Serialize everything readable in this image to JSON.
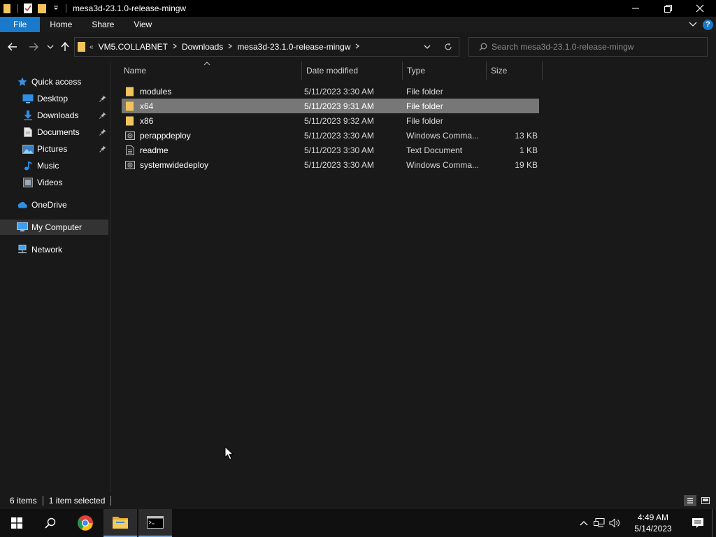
{
  "window": {
    "title": "mesa3d-23.1.0-release-mingw"
  },
  "ribbon": {
    "tabs": [
      "File",
      "Home",
      "Share",
      "View"
    ]
  },
  "address": {
    "overflow": "«",
    "crumbs": [
      "VM5.COLLABNET",
      "Downloads",
      "mesa3d-23.1.0-release-mingw"
    ]
  },
  "search": {
    "placeholder": "Search mesa3d-23.1.0-release-mingw"
  },
  "navpane": {
    "quick_access": "Quick access",
    "items": [
      {
        "label": "Desktop",
        "icon": "desktop-icon",
        "pinned": true
      },
      {
        "label": "Downloads",
        "icon": "download-icon",
        "pinned": true
      },
      {
        "label": "Documents",
        "icon": "documents-icon",
        "pinned": true
      },
      {
        "label": "Pictures",
        "icon": "pictures-icon",
        "pinned": true
      },
      {
        "label": "Music",
        "icon": "music-icon",
        "pinned": false
      },
      {
        "label": "Videos",
        "icon": "videos-icon",
        "pinned": false
      }
    ],
    "onedrive": "OneDrive",
    "my_computer": "My Computer",
    "network": "Network"
  },
  "columns": {
    "name": "Name",
    "date": "Date modified",
    "type": "Type",
    "size": "Size"
  },
  "files": [
    {
      "name": "modules",
      "date": "5/11/2023 3:30 AM",
      "type": "File folder",
      "size": "",
      "icon": "folder-icon",
      "selected": false
    },
    {
      "name": "x64",
      "date": "5/11/2023 9:31 AM",
      "type": "File folder",
      "size": "",
      "icon": "folder-icon",
      "selected": true
    },
    {
      "name": "x86",
      "date": "5/11/2023 9:32 AM",
      "type": "File folder",
      "size": "",
      "icon": "folder-icon",
      "selected": false
    },
    {
      "name": "perappdeploy",
      "date": "5/11/2023 3:30 AM",
      "type": "Windows Comma...",
      "size": "13 KB",
      "icon": "cmd-file-icon",
      "selected": false
    },
    {
      "name": "readme",
      "date": "5/11/2023 3:30 AM",
      "type": "Text Document",
      "size": "1 KB",
      "icon": "text-file-icon",
      "selected": false
    },
    {
      "name": "systemwidedeploy",
      "date": "5/11/2023 3:30 AM",
      "type": "Windows Comma...",
      "size": "19 KB",
      "icon": "cmd-file-icon",
      "selected": false
    }
  ],
  "status": {
    "count": "6 items",
    "selection": "1 item selected"
  },
  "taskbar": {
    "time": "4:49 AM",
    "date": "5/14/2023"
  },
  "colors": {
    "accent": "#1979ca",
    "folder": "#f2c55c",
    "selection": "#777777",
    "background": "#191919"
  }
}
